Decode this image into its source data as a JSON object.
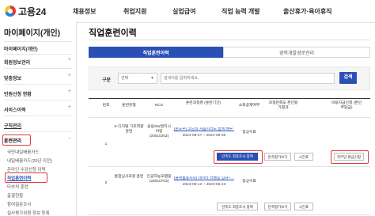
{
  "header": {
    "logo_text": "고용24",
    "nav": [
      "채용정보",
      "취업지원",
      "실업급여",
      "직업 능력 개발",
      "출산휴가·육아휴직"
    ]
  },
  "sidebar": {
    "title": "마이페이지(개인)",
    "items": [
      {
        "label": "마이페이지(개인)"
      },
      {
        "label": "회원정보관리"
      },
      {
        "label": "맞춤정보"
      },
      {
        "label": "민원신청 현황"
      },
      {
        "label": "서비스이력"
      },
      {
        "label": "구직관리"
      },
      {
        "label": "훈련관리"
      }
    ],
    "training_sub": [
      "국민내일배움카드",
      "내일배움카드(20년 이전)",
      "온라인 수강신청 이력",
      "직업훈련이력"
    ],
    "extra": [
      "타부처 훈련",
      "출결현황",
      "참여설문조사",
      "실사평가위원 정보 등록"
    ]
  },
  "main": {
    "title": "직업훈련이력",
    "tabs": [
      "직업훈련이력",
      "경력개발경로관리"
    ],
    "search": {
      "label": "구분",
      "select_value": "선택",
      "placeholder": "검색어를 입력하세요.",
      "button": "검색"
    },
    "columns": [
      "번호",
      "훈련유형",
      "NCS",
      "훈련과정명 (훈련기간)",
      "소득공제여부",
      "과정만족도 본인평가결과",
      "비용지급신청 (본인부담금)"
    ],
    "rows": [
      {
        "no": "1",
        "type": "K-디지털 기초역량훈련",
        "ncs": "응용SW엔지니어링 (20010202)",
        "course": "[윈도우] 코딩의 처음이라도 함께 배우…",
        "period": "2024-08-27 ~ 2024-09-30",
        "deduction": "정상수료",
        "buttons": [
          "만족도 최종조사 참여",
          "만족평가보기",
          "시간표",
          "자부담 환급신청"
        ]
      },
      {
        "no": "2",
        "type": "통합심사과정 훈련",
        "ncs": "인공지능모델링 (20010703)",
        "course": "[플랫폼종사자] 데이터 라벨링 심화~…",
        "period": "2023-05-12 ~ 2023-06-23",
        "deduction": "정상수료",
        "buttons": [
          "만족도 최종조사 참여",
          "만족평가보기",
          "시간표"
        ]
      }
    ]
  }
}
